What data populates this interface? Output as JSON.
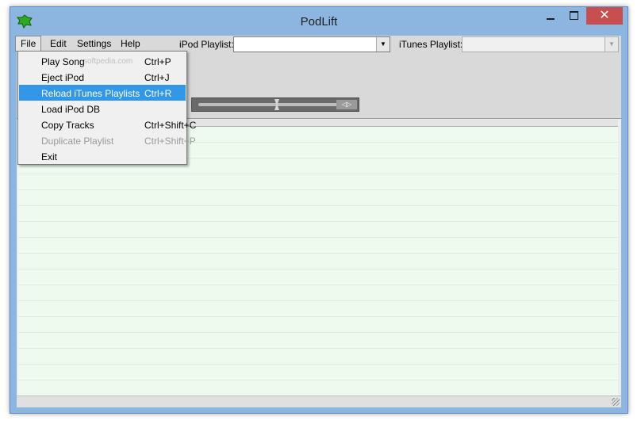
{
  "window": {
    "title": "PodLift"
  },
  "title_buttons": {
    "minimize_icon": "minimize-icon",
    "maximize_icon": "maximize-icon",
    "close_label": "✕"
  },
  "menubar": {
    "file": "File",
    "edit": "Edit",
    "settings": "Settings",
    "help": "Help"
  },
  "toolbar": {
    "ipod_playlist_label": "iPod Playlist:",
    "ipod_playlist_value": "",
    "itunes_playlist_label": "iTunes Playlist:",
    "itunes_playlist_value": "",
    "combo_arrow": "▼",
    "seek_buttons": "◁▷"
  },
  "file_menu": {
    "items": [
      {
        "label": "Play Song",
        "shortcut": "Ctrl+P",
        "state": "normal"
      },
      {
        "label": "Eject iPod",
        "shortcut": "Ctrl+J",
        "state": "normal"
      },
      {
        "label": "Reload iTunes Playlists",
        "shortcut": "Ctrl+R",
        "state": "selected"
      },
      {
        "label": "Load iPod DB",
        "shortcut": "",
        "state": "normal"
      },
      {
        "label": "Copy Tracks",
        "shortcut": "Ctrl+Shift+C",
        "state": "normal"
      },
      {
        "label": "Duplicate Playlist",
        "shortcut": "Ctrl+Shift+P",
        "state": "disabled"
      },
      {
        "label": "Exit",
        "shortcut": "",
        "state": "normal"
      }
    ]
  },
  "watermark": "softpedia.com",
  "colors": {
    "selected": "#3397e8",
    "list_bg": "#eefaee",
    "close_button": "#c74f4f"
  }
}
